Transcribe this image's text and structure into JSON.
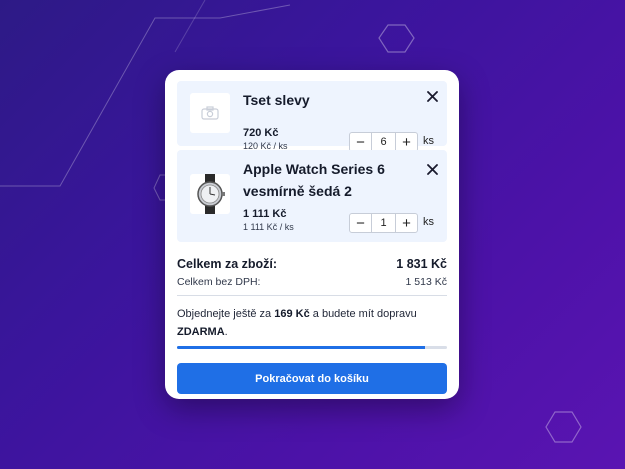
{
  "cart": {
    "items": [
      {
        "name": "Tset slevy",
        "price": "720 Kč",
        "unit_price": "120 Kč / ks",
        "quantity": "6",
        "unit": "ks",
        "image_icon": "camera-placeholder-icon"
      },
      {
        "name_line1": "Apple Watch Series 6",
        "name_line2": "vesmírně šedá 2",
        "price": "1 111 Kč",
        "unit_price": "1 111 Kč / ks",
        "quantity": "1",
        "unit": "ks",
        "image_icon": "watch-product-image"
      }
    ],
    "controls": {
      "minus": "−",
      "plus": "+",
      "close": "close-icon"
    }
  },
  "summary": {
    "total_label": "Celkem za zboží:",
    "total_value": "1 831 Kč",
    "vat_label": "Celkem bez DPH:",
    "vat_value": "1 513 Kč"
  },
  "shipping": {
    "text_before": "Objednejte ještě za ",
    "amount": "169 Kč",
    "text_middle": " a budete mít dopravu ",
    "free": "ZDARMA",
    "text_after": ".",
    "progress_percent": 92
  },
  "checkout": {
    "button_label": "Pokračovat do košíku"
  },
  "colors": {
    "accent": "#1f6fe6",
    "item_background": "#eef4fe",
    "page_background": "#3a159c"
  }
}
